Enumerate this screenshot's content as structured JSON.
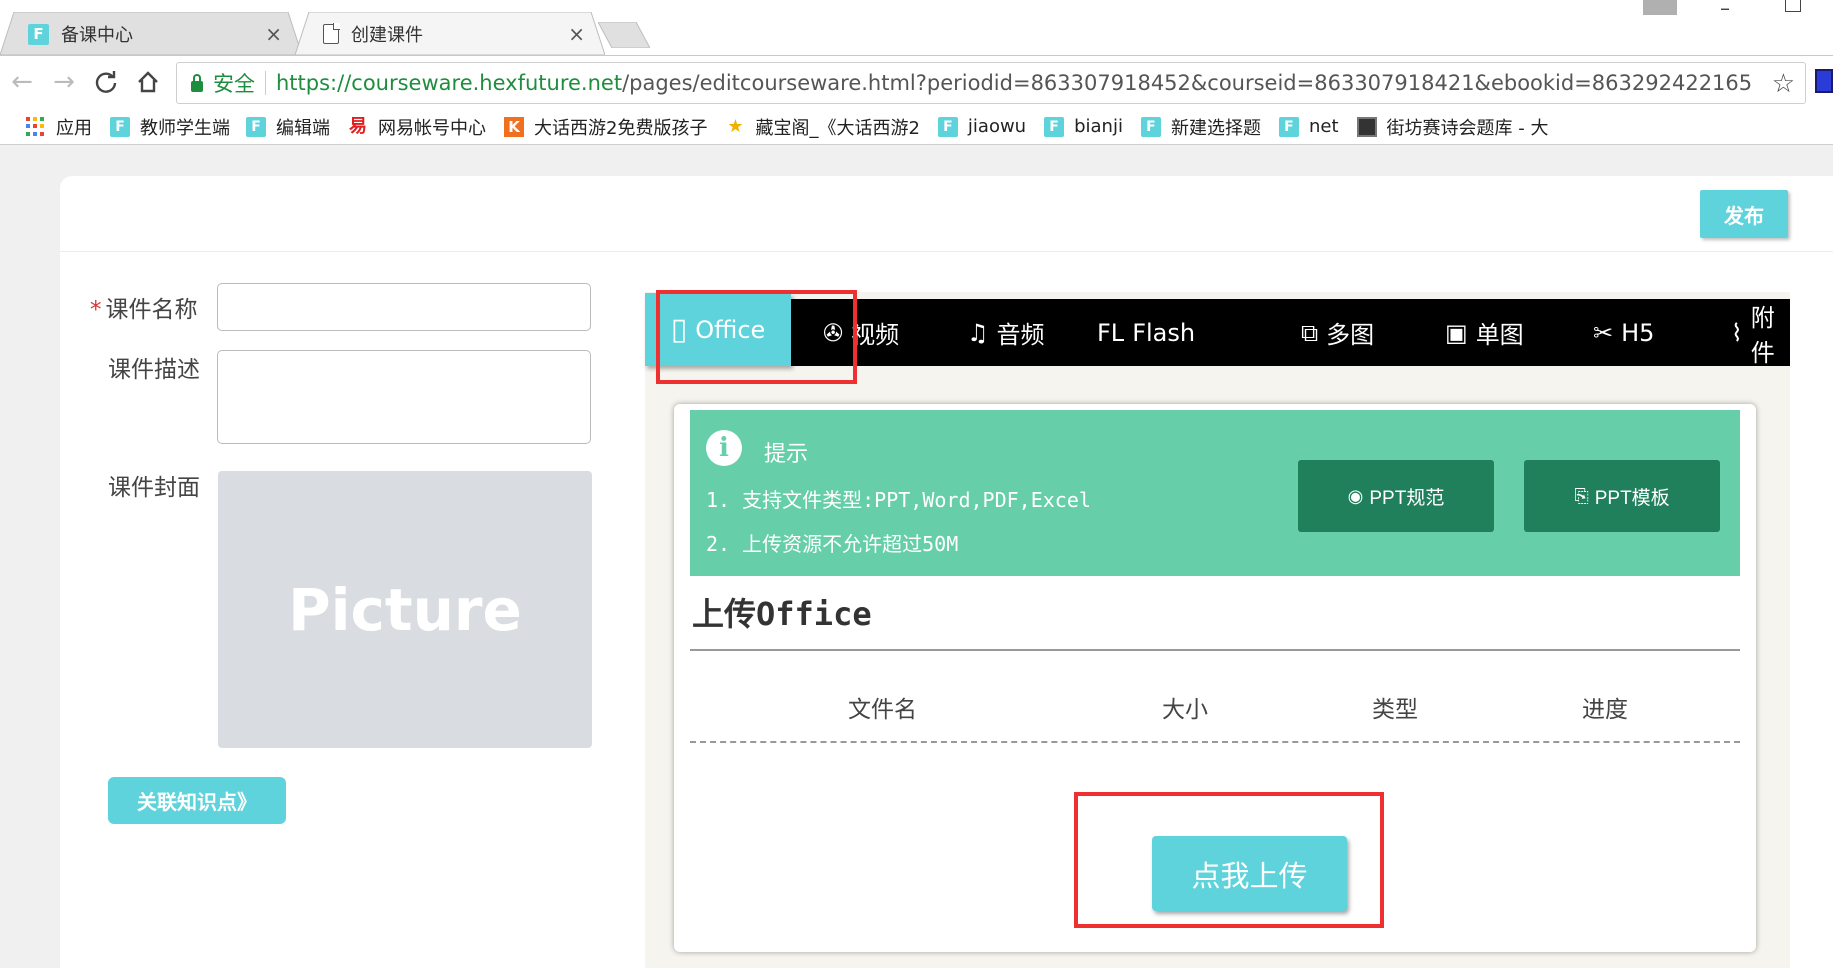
{
  "browser": {
    "tabs": [
      {
        "title": "备课中心",
        "icon": "F",
        "close": "×",
        "active": false
      },
      {
        "title": "创建课件",
        "icon": "document-icon",
        "close": "×",
        "active": true
      }
    ],
    "toolbar": {
      "back": "←",
      "forward": "→",
      "reload": "C",
      "home": "⌂",
      "secure_label": "安全",
      "url_host": "https://courseware.hexfuture.net",
      "url_path": "/pages/editcourseware.html?periodid=863307918452&courseid=863307918421&ebookid=863292422165",
      "star": "☆"
    },
    "bookmarks": {
      "apps": "应用",
      "items": [
        {
          "label": "教师学生端",
          "icon": "F"
        },
        {
          "label": "编辑端",
          "icon": "F"
        },
        {
          "label": "网易帐号中心",
          "icon": "易"
        },
        {
          "label": "大话西游2免费版孩子",
          "icon": "K"
        },
        {
          "label": "藏宝阁_《大话西游2",
          "icon": "★"
        },
        {
          "label": "jiaowu",
          "icon": "F"
        },
        {
          "label": "bianji",
          "icon": "F"
        },
        {
          "label": "新建选择题",
          "icon": "F"
        },
        {
          "label": "net",
          "icon": "F"
        },
        {
          "label": "街坊赛诗会题库 - 大",
          "icon": "film"
        }
      ]
    }
  },
  "header": {
    "publish_label": "发布"
  },
  "form": {
    "required_mark": "*",
    "name_label": "课件名称",
    "desc_label": "课件描述",
    "cover_label": "课件封面",
    "cover_placeholder": "Picture",
    "knowledge_button": "关联知识点》"
  },
  "type_tabs": {
    "items": [
      {
        "label": "Office",
        "icon": "▯",
        "active": true
      },
      {
        "label": "视频",
        "icon": "✇"
      },
      {
        "label": "音频",
        "icon": "♫"
      },
      {
        "label": "Flash",
        "icon": "FL"
      },
      {
        "label": "多图",
        "icon": "⧉"
      },
      {
        "label": "单图",
        "icon": "▣"
      },
      {
        "label": "H5",
        "icon": "✂"
      },
      {
        "label": "附件",
        "icon": "⌇"
      }
    ]
  },
  "upload": {
    "tip_icon": "i",
    "tip_title": "提示",
    "tip_lines": [
      "1. 支持文件类型:PPT,Word,PDF,Excel",
      "2. 上传资源不允许超过50M"
    ],
    "spec_button": "PPT规范",
    "spec_icon": "◉",
    "template_button": "PPT模板",
    "template_icon": "⎘",
    "title": "上传Office",
    "columns": [
      "文件名",
      "大小",
      "类型",
      "进度"
    ],
    "upload_button": "点我上传"
  },
  "colors": {
    "accent": "#5fd3dc",
    "tip_bg": "#66cfaa",
    "tip_button": "#20805c",
    "highlight_red": "#ee3030"
  }
}
